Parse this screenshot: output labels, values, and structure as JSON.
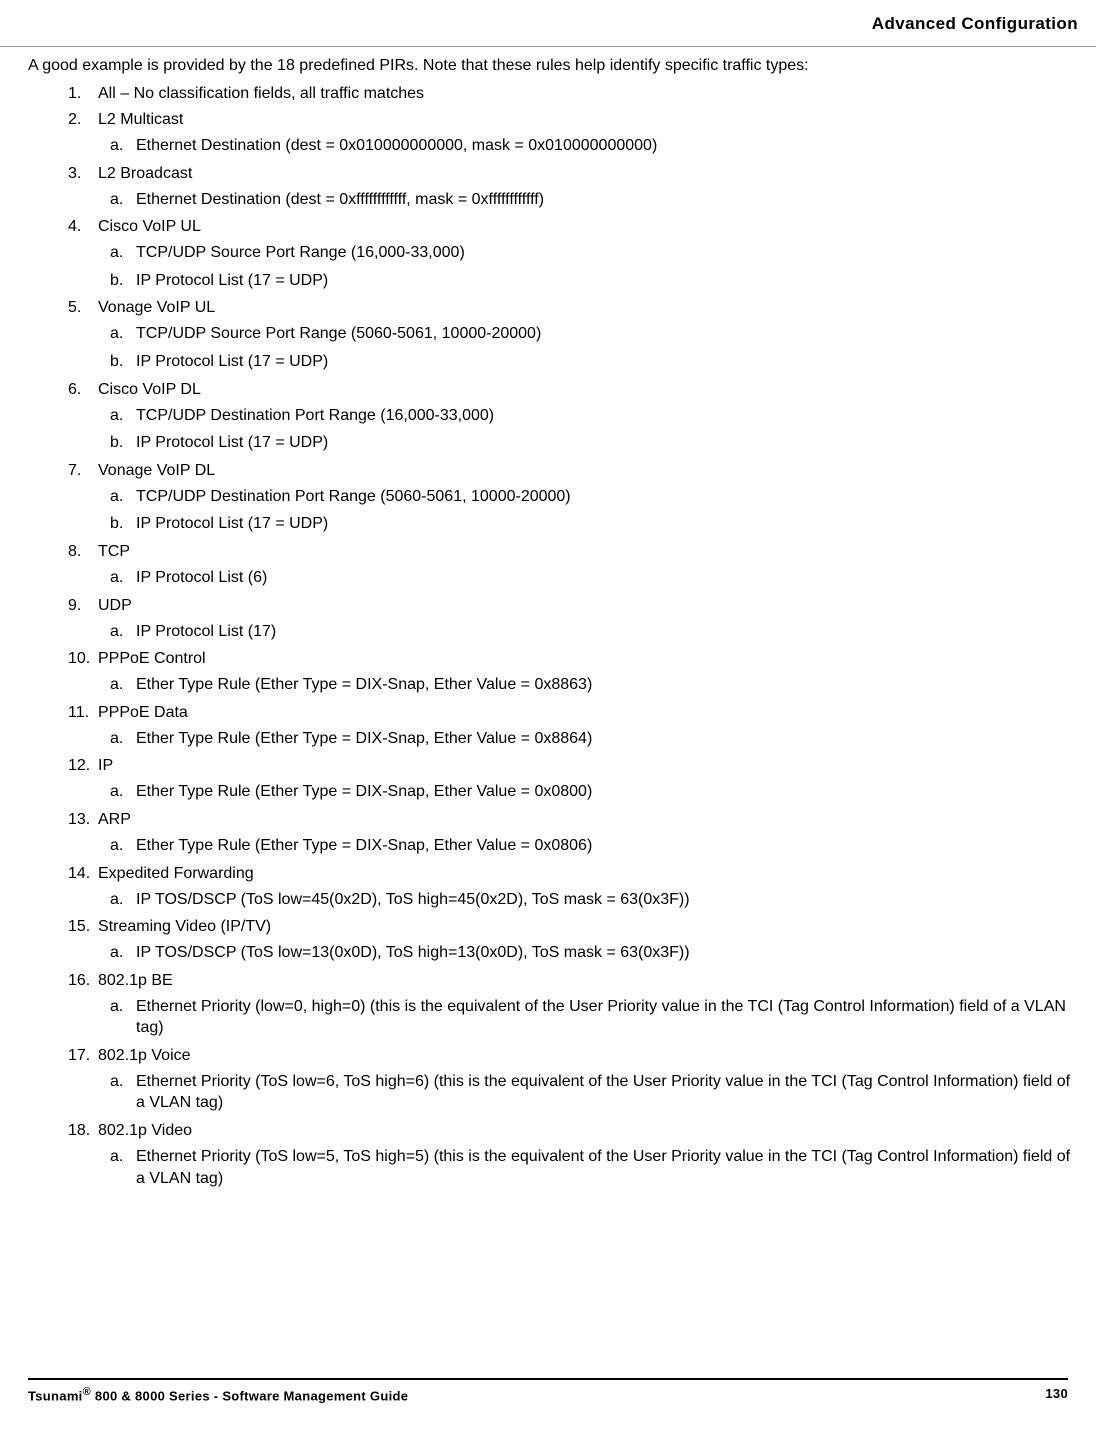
{
  "header": {
    "section_title": "Advanced Configuration"
  },
  "intro": "A good example is provided by the 18 predefined PIRs. Note that these rules help identify specific traffic types:",
  "rules": [
    {
      "n": "1.",
      "title": "All – No classification fields, all traffic matches",
      "subs": []
    },
    {
      "n": "2.",
      "title": "L2 Multicast",
      "subs": [
        {
          "l": "a.",
          "text": "Ethernet Destination (dest = 0x010000000000, mask = 0x010000000000)"
        }
      ]
    },
    {
      "n": "3.",
      "title": "L2 Broadcast",
      "subs": [
        {
          "l": "a.",
          "text": "Ethernet Destination (dest = 0xffffffffffff, mask = 0xffffffffffff)"
        }
      ]
    },
    {
      "n": "4.",
      "title": "Cisco VoIP UL",
      "subs": [
        {
          "l": "a.",
          "text": "TCP/UDP Source Port Range (16,000-33,000)"
        },
        {
          "l": "b.",
          "text": "IP Protocol List (17 = UDP)"
        }
      ]
    },
    {
      "n": "5.",
      "title": "Vonage VoIP UL",
      "subs": [
        {
          "l": "a.",
          "text": "TCP/UDP Source Port Range (5060-5061, 10000-20000)"
        },
        {
          "l": "b.",
          "text": "IP Protocol List (17 = UDP)"
        }
      ]
    },
    {
      "n": "6.",
      "title": "Cisco VoIP DL",
      "subs": [
        {
          "l": "a.",
          "text": "TCP/UDP Destination Port Range (16,000-33,000)"
        },
        {
          "l": "b.",
          "text": "IP Protocol List (17 = UDP)"
        }
      ]
    },
    {
      "n": "7.",
      "title": "Vonage VoIP DL",
      "subs": [
        {
          "l": "a.",
          "text": "TCP/UDP Destination Port Range (5060-5061, 10000-20000)"
        },
        {
          "l": "b.",
          "text": "IP Protocol List (17 = UDP)"
        }
      ]
    },
    {
      "n": "8.",
      "title": "TCP",
      "subs": [
        {
          "l": "a.",
          "text": "IP Protocol List (6)"
        }
      ]
    },
    {
      "n": "9.",
      "title": "UDP",
      "subs": [
        {
          "l": "a.",
          "text": "IP Protocol List (17)"
        }
      ]
    },
    {
      "n": "10.",
      "title": "PPPoE Control",
      "subs": [
        {
          "l": "a.",
          "text": "Ether Type Rule (Ether Type = DIX-Snap, Ether Value = 0x8863)"
        }
      ]
    },
    {
      "n": "11.",
      "title": "PPPoE Data",
      "subs": [
        {
          "l": "a.",
          "text": "Ether Type Rule (Ether Type = DIX-Snap, Ether Value = 0x8864)"
        }
      ]
    },
    {
      "n": "12.",
      "title": "IP",
      "subs": [
        {
          "l": "a.",
          "text": "Ether Type Rule (Ether Type = DIX-Snap, Ether Value = 0x0800)"
        }
      ]
    },
    {
      "n": "13.",
      "title": "ARP",
      "subs": [
        {
          "l": "a.",
          "text": " Ether Type Rule (Ether Type = DIX-Snap, Ether Value = 0x0806)"
        }
      ]
    },
    {
      "n": "14.",
      "title": "Expedited Forwarding",
      "subs": [
        {
          "l": "a.",
          "text": "IP TOS/DSCP (ToS low=45(0x2D), ToS high=45(0x2D), ToS mask = 63(0x3F))"
        }
      ]
    },
    {
      "n": "15.",
      "title": "Streaming Video (IP/TV)",
      "subs": [
        {
          "l": "a.",
          "text": "IP TOS/DSCP (ToS low=13(0x0D), ToS high=13(0x0D), ToS mask = 63(0x3F))"
        }
      ]
    },
    {
      "n": "16.",
      "title": "802.1p BE",
      "subs": [
        {
          "l": "a.",
          "text": "Ethernet Priority (low=0, high=0) (this is the equivalent of the User Priority value in the TCI (Tag Control Information) field of a VLAN tag)"
        }
      ]
    },
    {
      "n": "17.",
      "title": "802.1p Voice",
      "subs": [
        {
          "l": "a.",
          "text": "Ethernet Priority (ToS low=6, ToS high=6) (this is the equivalent of the User Priority value in the TCI (Tag Control Information) field of a VLAN tag)"
        }
      ]
    },
    {
      "n": "18.",
      "title": "802.1p Video",
      "subs": [
        {
          "l": "a.",
          "text": "Ethernet Priority (ToS low=5, ToS high=5) (this is the equivalent of the User Priority value in the TCI (Tag Control Information) field of a VLAN tag)"
        }
      ]
    }
  ],
  "footer": {
    "product_prefix": "Tsunami",
    "product_suffix": " 800 & 8000 Series - Software Management Guide",
    "page_number": "130"
  }
}
